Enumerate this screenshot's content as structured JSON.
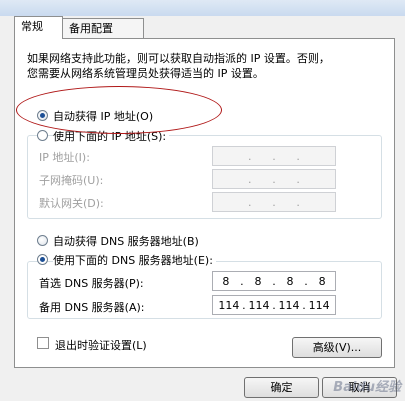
{
  "title_fragment": "",
  "tabs": [
    {
      "label": "常规"
    },
    {
      "label": "备用配置"
    }
  ],
  "description_line1": "如果网络支持此功能，则可以获取自动指派的 IP 设置。否则，",
  "description_line2": "您需要从网络系统管理员处获得适当的 IP 设置。",
  "ip": {
    "auto_label": "自动获得 IP 地址(O)",
    "manual_label": "使用下面的 IP 地址(S):",
    "address_label": "IP 地址(I):",
    "subnet_label": "子网掩码(U):",
    "gateway_label": "默认网关(D):",
    "separator": "."
  },
  "dns": {
    "auto_label": "自动获得 DNS 服务器地址(B)",
    "manual_label": "使用下面的 DNS 服务器地址(E):",
    "preferred_label": "首选 DNS 服务器(P):",
    "alternate_label": "备用 DNS 服务器(A):",
    "preferred_octets": [
      "8",
      "8",
      "8",
      "8"
    ],
    "alternate_octets": [
      "114",
      "114",
      "114",
      "114"
    ]
  },
  "validate_label": "退出时验证设置(L)",
  "advanced_label": "高级(V)...",
  "ok_label": "确定",
  "cancel_label": "取消",
  "watermark": "Baidu经验"
}
